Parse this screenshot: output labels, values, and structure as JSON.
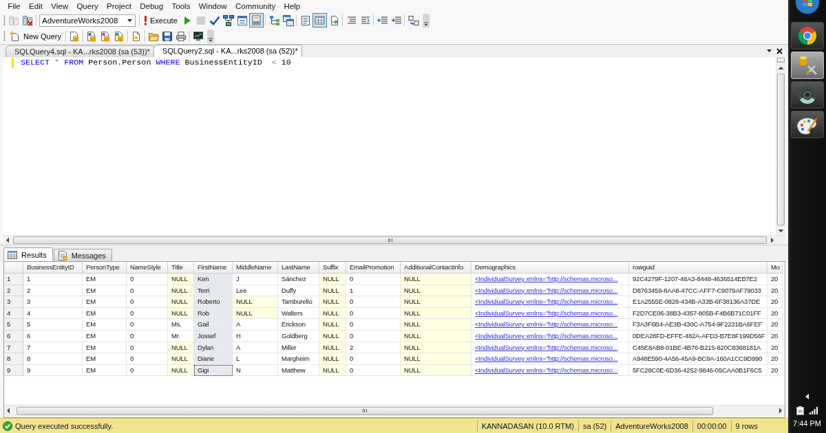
{
  "menu_bar": {
    "items": [
      "File",
      "Edit",
      "View",
      "Query",
      "Project",
      "Debug",
      "Tools",
      "Window",
      "Community",
      "Help"
    ]
  },
  "toolbar_1": {
    "items": [
      {
        "kind": "server",
        "pressed": false,
        "disabled": true
      },
      {
        "kind": "reconnect",
        "pressed": false,
        "disabled": false
      },
      {
        "kind": "separator"
      },
      {
        "kind": "combo",
        "value": "AdventureWorks2008"
      },
      {
        "kind": "separator"
      },
      {
        "kind": "execute",
        "label": "Execute"
      },
      {
        "kind": "play",
        "pressed": false,
        "disabled": false
      },
      {
        "kind": "stop",
        "pressed": false,
        "disabled": true
      },
      {
        "kind": "check",
        "pressed": false,
        "disabled": false
      },
      {
        "kind": "flow",
        "pressed": false,
        "disabled": false
      },
      {
        "kind": "form",
        "pressed": false,
        "disabled": false
      },
      {
        "kind": "panel",
        "pressed": true,
        "disabled": false
      },
      {
        "kind": "separator"
      },
      {
        "kind": "tree",
        "pressed": false,
        "disabled": false
      },
      {
        "kind": "windows",
        "pressed": false,
        "disabled": false
      },
      {
        "kind": "separator"
      },
      {
        "kind": "text",
        "pressed": false,
        "disabled": false
      },
      {
        "kind": "table",
        "pressed": true,
        "disabled": false
      },
      {
        "kind": "file",
        "pressed": false,
        "disabled": false
      },
      {
        "kind": "separator"
      },
      {
        "kind": "lines",
        "pressed": false,
        "disabled": false
      },
      {
        "kind": "unlines",
        "pressed": false,
        "disabled": false
      },
      {
        "kind": "separator"
      },
      {
        "kind": "outdent",
        "pressed": false,
        "disabled": false
      },
      {
        "kind": "indent",
        "pressed": false,
        "disabled": false
      },
      {
        "kind": "separator"
      },
      {
        "kind": "swap",
        "pressed": false,
        "disabled": false
      }
    ]
  },
  "toolbar_2": {
    "items": [
      {
        "kind": "newquery",
        "label": "New Query"
      },
      {
        "kind": "separator"
      },
      {
        "kind": "dbdoc",
        "pressed": false,
        "disabled": false
      },
      {
        "kind": "separator"
      },
      {
        "kind": "mdx",
        "pressed": false,
        "disabled": false
      },
      {
        "kind": "dmx",
        "pressed": false,
        "disabled": false
      },
      {
        "kind": "xmla",
        "pressed": false,
        "disabled": false
      },
      {
        "kind": "separator"
      },
      {
        "kind": "doc",
        "pressed": false,
        "disabled": false
      },
      {
        "kind": "separator"
      },
      {
        "kind": "folder",
        "pressed": false,
        "disabled": false
      },
      {
        "kind": "save",
        "pressed": false,
        "disabled": false
      },
      {
        "kind": "printer",
        "pressed": false,
        "disabled": false
      },
      {
        "kind": "separator"
      },
      {
        "kind": "monitor",
        "pressed": false,
        "disabled": false
      }
    ]
  },
  "doc_tabs": {
    "tabs": [
      {
        "label": "SQLQuery4.sql - KA...rks2008 (sa (53))*",
        "selected": false
      },
      {
        "label": "SQLQuery2.sql - KA...rks2008 (sa (52))*",
        "selected": true
      }
    ]
  },
  "editor": {
    "lines": [
      {
        "modified": true,
        "tokens": [
          {
            "text": "SELECT",
            "kind": "keyword"
          },
          {
            "text": " * ",
            "kind": "operator"
          },
          {
            "text": "FROM",
            "kind": "keyword"
          },
          {
            "text": " Person.Person ",
            "kind": "plain"
          },
          {
            "text": "WHERE",
            "kind": "keyword"
          },
          {
            "text": " BusinessEntityID  ",
            "kind": "plain"
          },
          {
            "text": "<",
            "kind": "operator"
          },
          {
            "text": " 10",
            "kind": "plain"
          }
        ]
      }
    ]
  },
  "results": {
    "tabs": [
      {
        "label": "Results",
        "selected": true
      },
      {
        "label": "Messages",
        "selected": false
      }
    ],
    "columns": [
      {
        "label": "BusinessEntityID",
        "selected": false
      },
      {
        "label": "PersonType",
        "selected": false
      },
      {
        "label": "NameStyle",
        "selected": false
      },
      {
        "label": "Title",
        "selected": false
      },
      {
        "label": "FirstName",
        "selected": true
      },
      {
        "label": "MiddleName",
        "selected": false
      },
      {
        "label": "LastName",
        "selected": false
      },
      {
        "label": "Suffix",
        "selected": false
      },
      {
        "label": "EmailPromotion",
        "selected": false
      },
      {
        "label": "AdditionalContactInfo",
        "selected": false
      },
      {
        "label": "Demographics",
        "selected": false
      },
      {
        "label": "rowguid",
        "selected": false
      },
      {
        "label": "Mo",
        "selected": false
      }
    ],
    "rows": [
      {
        "number": "1",
        "current": false,
        "cells": [
          {
            "text": "1",
            "kind": "value"
          },
          {
            "text": "EM",
            "kind": "value"
          },
          {
            "text": "0",
            "kind": "value"
          },
          {
            "text": "NULL",
            "kind": "null"
          },
          {
            "text": "Ken",
            "kind": "value"
          },
          {
            "text": "J",
            "kind": "value"
          },
          {
            "text": "Sánchez",
            "kind": "value"
          },
          {
            "text": "NULL",
            "kind": "null"
          },
          {
            "text": "0",
            "kind": "value"
          },
          {
            "text": "NULL",
            "kind": "null"
          },
          {
            "text": "<IndividualSurvey xmlns=\"http://schemas.microso...",
            "kind": "link"
          },
          {
            "text": "92C4279F-1207-48A3-8448-4636514EB7E2",
            "kind": "value"
          },
          {
            "text": "20",
            "kind": "value"
          }
        ]
      },
      {
        "number": "2",
        "current": false,
        "cells": [
          {
            "text": "2",
            "kind": "value"
          },
          {
            "text": "EM",
            "kind": "value"
          },
          {
            "text": "0",
            "kind": "value"
          },
          {
            "text": "NULL",
            "kind": "null"
          },
          {
            "text": "Terri",
            "kind": "value"
          },
          {
            "text": "Lee",
            "kind": "value"
          },
          {
            "text": "Duffy",
            "kind": "value"
          },
          {
            "text": "NULL",
            "kind": "null"
          },
          {
            "text": "1",
            "kind": "value"
          },
          {
            "text": "NULL",
            "kind": "null"
          },
          {
            "text": "<IndividualSurvey xmlns=\"http://schemas.microso...",
            "kind": "link"
          },
          {
            "text": "D8763459-8AA8-47CC-AFF7-C9079AF79033",
            "kind": "value"
          },
          {
            "text": "20",
            "kind": "value"
          }
        ]
      },
      {
        "number": "3",
        "current": false,
        "cells": [
          {
            "text": "3",
            "kind": "value"
          },
          {
            "text": "EM",
            "kind": "value"
          },
          {
            "text": "0",
            "kind": "value"
          },
          {
            "text": "NULL",
            "kind": "null"
          },
          {
            "text": "Roberto",
            "kind": "value"
          },
          {
            "text": "NULL",
            "kind": "null"
          },
          {
            "text": "Tamburello",
            "kind": "value"
          },
          {
            "text": "NULL",
            "kind": "null"
          },
          {
            "text": "0",
            "kind": "value"
          },
          {
            "text": "NULL",
            "kind": "null"
          },
          {
            "text": "<IndividualSurvey xmlns=\"http://schemas.microso...",
            "kind": "link"
          },
          {
            "text": "E1A2555E-0828-434B-A33B-6F38136A37DE",
            "kind": "value"
          },
          {
            "text": "20",
            "kind": "value"
          }
        ]
      },
      {
        "number": "4",
        "current": false,
        "cells": [
          {
            "text": "4",
            "kind": "value"
          },
          {
            "text": "EM",
            "kind": "value"
          },
          {
            "text": "0",
            "kind": "value"
          },
          {
            "text": "NULL",
            "kind": "null"
          },
          {
            "text": "Rob",
            "kind": "value"
          },
          {
            "text": "NULL",
            "kind": "null"
          },
          {
            "text": "Walters",
            "kind": "value"
          },
          {
            "text": "NULL",
            "kind": "null"
          },
          {
            "text": "0",
            "kind": "value"
          },
          {
            "text": "NULL",
            "kind": "null"
          },
          {
            "text": "<IndividualSurvey xmlns=\"http://schemas.microso...",
            "kind": "link"
          },
          {
            "text": "F2D7CE06-38B3-4357-805B-F4B6B71C01FF",
            "kind": "value"
          },
          {
            "text": "20",
            "kind": "value"
          }
        ]
      },
      {
        "number": "5",
        "current": false,
        "cells": [
          {
            "text": "5",
            "kind": "value"
          },
          {
            "text": "EM",
            "kind": "value"
          },
          {
            "text": "0",
            "kind": "value"
          },
          {
            "text": "Ms.",
            "kind": "value"
          },
          {
            "text": "Gail",
            "kind": "value"
          },
          {
            "text": "A",
            "kind": "value"
          },
          {
            "text": "Erickson",
            "kind": "value"
          },
          {
            "text": "NULL",
            "kind": "null"
          },
          {
            "text": "0",
            "kind": "value"
          },
          {
            "text": "NULL",
            "kind": "null"
          },
          {
            "text": "<IndividualSurvey xmlns=\"http://schemas.microso...",
            "kind": "link"
          },
          {
            "text": "F3A3F6B4-AE3B-430C-A754-9F2231BA6FEF",
            "kind": "value"
          },
          {
            "text": "20",
            "kind": "value"
          }
        ]
      },
      {
        "number": "6",
        "current": false,
        "cells": [
          {
            "text": "6",
            "kind": "value"
          },
          {
            "text": "EM",
            "kind": "value"
          },
          {
            "text": "0",
            "kind": "value"
          },
          {
            "text": "Mr.",
            "kind": "value"
          },
          {
            "text": "Jossef",
            "kind": "value"
          },
          {
            "text": "H",
            "kind": "value"
          },
          {
            "text": "Goldberg",
            "kind": "value"
          },
          {
            "text": "NULL",
            "kind": "null"
          },
          {
            "text": "0",
            "kind": "value"
          },
          {
            "text": "NULL",
            "kind": "null"
          },
          {
            "text": "<IndividualSurvey xmlns=\"http://schemas.microso...",
            "kind": "link"
          },
          {
            "text": "0DEA28FD-EFFE-482A-AFD3-B7E8F199D56F",
            "kind": "value"
          },
          {
            "text": "20",
            "kind": "value"
          }
        ]
      },
      {
        "number": "7",
        "current": false,
        "cells": [
          {
            "text": "7",
            "kind": "value"
          },
          {
            "text": "EM",
            "kind": "value"
          },
          {
            "text": "0",
            "kind": "value"
          },
          {
            "text": "NULL",
            "kind": "null"
          },
          {
            "text": "Dylan",
            "kind": "value"
          },
          {
            "text": "A",
            "kind": "value"
          },
          {
            "text": "Miller",
            "kind": "value"
          },
          {
            "text": "NULL",
            "kind": "null"
          },
          {
            "text": "2",
            "kind": "value"
          },
          {
            "text": "NULL",
            "kind": "null"
          },
          {
            "text": "<IndividualSurvey xmlns=\"http://schemas.microso...",
            "kind": "link"
          },
          {
            "text": "C45E8AB8-01BE-4B76-B215-820C8368181A",
            "kind": "value"
          },
          {
            "text": "20",
            "kind": "value"
          }
        ]
      },
      {
        "number": "8",
        "current": false,
        "cells": [
          {
            "text": "8",
            "kind": "value"
          },
          {
            "text": "EM",
            "kind": "value"
          },
          {
            "text": "0",
            "kind": "value"
          },
          {
            "text": "NULL",
            "kind": "null"
          },
          {
            "text": "Diane",
            "kind": "value"
          },
          {
            "text": "L",
            "kind": "value"
          },
          {
            "text": "Margheim",
            "kind": "value"
          },
          {
            "text": "NULL",
            "kind": "null"
          },
          {
            "text": "0",
            "kind": "value"
          },
          {
            "text": "NULL",
            "kind": "null"
          },
          {
            "text": "<IndividualSurvey xmlns=\"http://schemas.microso...",
            "kind": "link"
          },
          {
            "text": "A948E590-4A56-45A9-BC9A-160A1CC9D990",
            "kind": "value"
          },
          {
            "text": "20",
            "kind": "value"
          }
        ]
      },
      {
        "number": "9",
        "current": true,
        "cells": [
          {
            "text": "9",
            "kind": "value"
          },
          {
            "text": "EM",
            "kind": "value"
          },
          {
            "text": "0",
            "kind": "value"
          },
          {
            "text": "NULL",
            "kind": "null"
          },
          {
            "text": "Gigi",
            "kind": "value"
          },
          {
            "text": "N",
            "kind": "value"
          },
          {
            "text": "Matthew",
            "kind": "value"
          },
          {
            "text": "NULL",
            "kind": "null"
          },
          {
            "text": "0",
            "kind": "value"
          },
          {
            "text": "NULL",
            "kind": "null"
          },
          {
            "text": "<IndividualSurvey xmlns=\"http://schemas.microso...",
            "kind": "link"
          },
          {
            "text": "5FC28C0E-6D36-4252-9846-05CAA0B1F6C5",
            "kind": "value"
          },
          {
            "text": "20",
            "kind": "value"
          }
        ]
      }
    ]
  },
  "status_bar": {
    "message": "Query executed successfully.",
    "segments": [
      "KANNADASAN (10.0 RTM)",
      "sa (52)",
      "AdventureWorks2008",
      "00:00:00",
      "9 rows"
    ]
  },
  "taskbar": {
    "apps": [
      {
        "kind": "browser",
        "active": false
      },
      {
        "kind": "dbtools",
        "active": true
      },
      {
        "kind": "disc",
        "active": false
      },
      {
        "kind": "palette",
        "active": false
      }
    ],
    "tray": {
      "time": "7:44 PM"
    }
  }
}
